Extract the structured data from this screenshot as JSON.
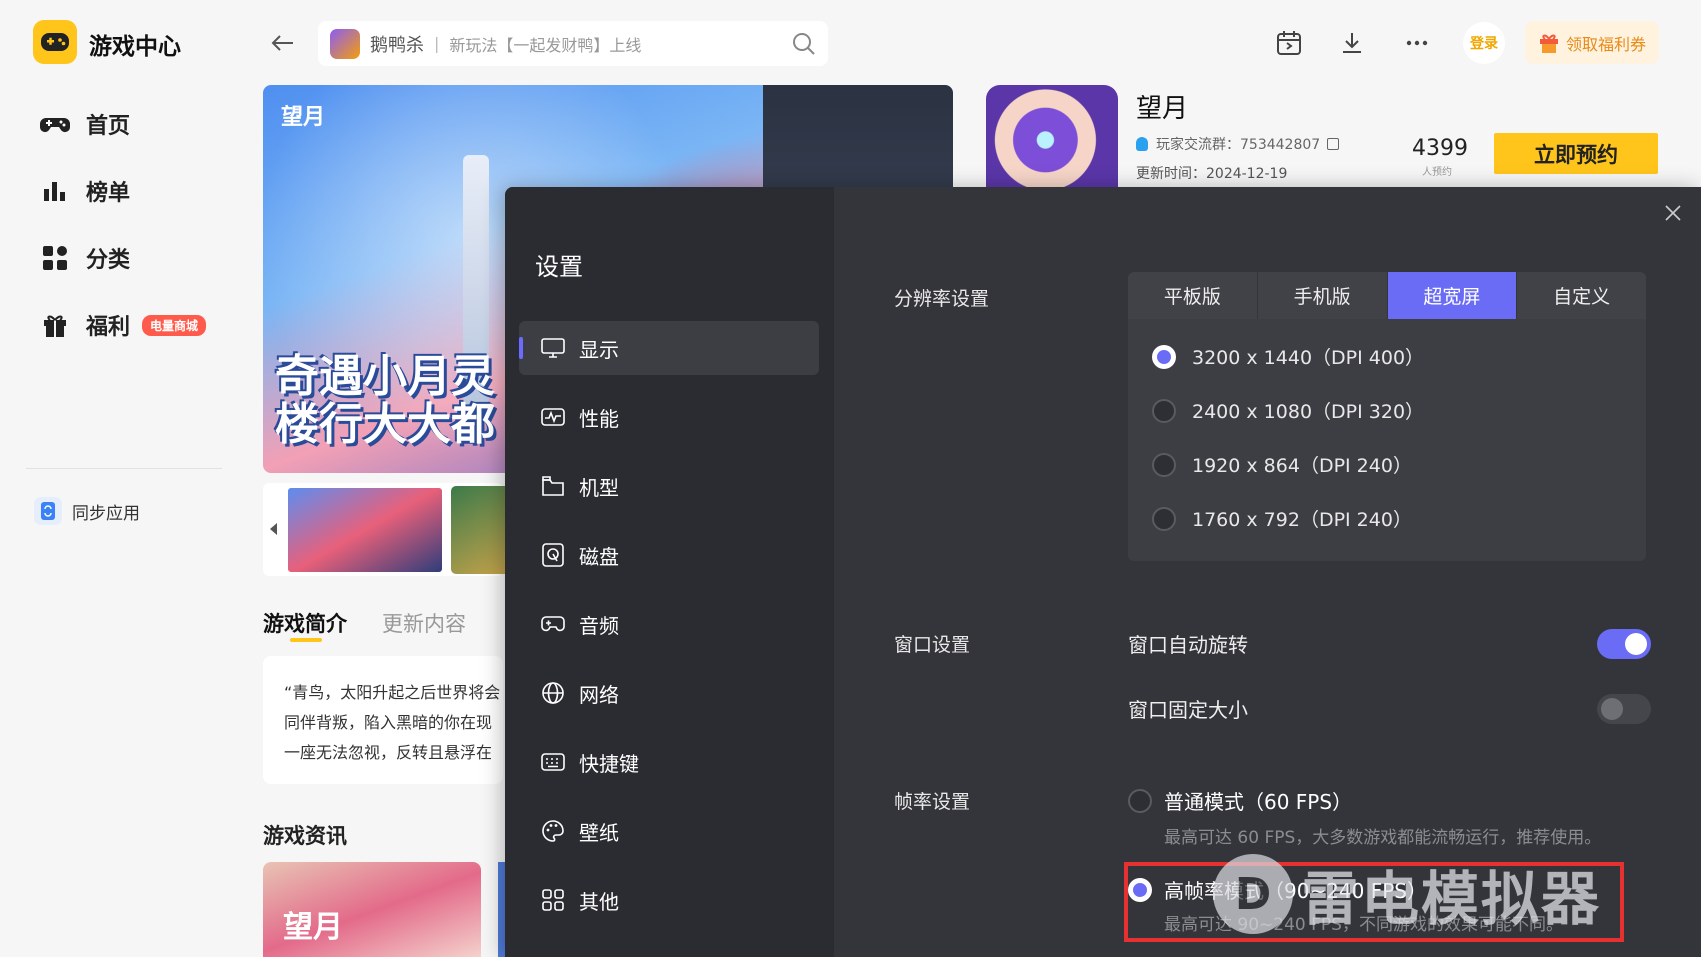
{
  "app": {
    "title": "游戏中心"
  },
  "sidebar": {
    "items": [
      {
        "label": "首页",
        "icon": "gamepad-icon"
      },
      {
        "label": "榜单",
        "icon": "bar-chart-icon"
      },
      {
        "label": "分类",
        "icon": "category-grid-icon"
      },
      {
        "label": "福利",
        "icon": "gift-icon",
        "badge": "电量商城"
      }
    ],
    "sync": {
      "label": "同步应用",
      "icon": "sync-app-icon"
    }
  },
  "topbar": {
    "search": {
      "game": "鹅鸭杀",
      "hint": "新玩法【一起发财鸭】上线",
      "sep": "|"
    },
    "login_label": "登录",
    "welfare_label": "领取福利券"
  },
  "banner": {
    "logo": "望月",
    "title_line1": "奇遇小月灵",
    "title_line2": "楼行大大都"
  },
  "main": {
    "tabs": [
      "游戏简介",
      "更新内容"
    ],
    "intro_lines": [
      "“青鸟，太阳升起之后世界将会",
      "同伴背叛，陷入黑暗的你在现",
      "一座无法忽视，反转且悬浮在"
    ],
    "news_title": "游戏资讯",
    "news_logo": "望月"
  },
  "game": {
    "name": "望月",
    "qq_group": "玩家交流群：753442807",
    "update_time": "更新时间：2024-12-19",
    "reserve_count": "4399",
    "reserve_count_label": "人预约",
    "reserve_btn": "立即预约"
  },
  "settings": {
    "title": "设置",
    "nav": [
      {
        "label": "显示",
        "icon": "monitor-icon",
        "active": true
      },
      {
        "label": "性能",
        "icon": "performance-icon",
        "active": false
      },
      {
        "label": "机型",
        "icon": "device-model-icon",
        "active": false
      },
      {
        "label": "磁盘",
        "icon": "disk-icon",
        "active": false
      },
      {
        "label": "音频",
        "icon": "audio-gamepad-icon",
        "active": false
      },
      {
        "label": "网络",
        "icon": "globe-icon",
        "active": false
      },
      {
        "label": "快捷键",
        "icon": "keyboard-icon",
        "active": false
      },
      {
        "label": "壁纸",
        "icon": "palette-icon",
        "active": false
      },
      {
        "label": "其他",
        "icon": "more-grid-icon",
        "active": false
      }
    ],
    "resolution": {
      "label": "分辨率设置",
      "tabs": [
        "平板版",
        "手机版",
        "超宽屏",
        "自定义"
      ],
      "active_tab": "超宽屏",
      "options": [
        {
          "label": "3200 x 1440（DPI 400）",
          "checked": true
        },
        {
          "label": "2400 x 1080（DPI 320）",
          "checked": false
        },
        {
          "label": "1920 x 864（DPI 240）",
          "checked": false
        },
        {
          "label": "1760 x 792（DPI 240）",
          "checked": false
        }
      ]
    },
    "window": {
      "label": "窗口设置",
      "auto_rotate": {
        "label": "窗口自动旋转",
        "on": true
      },
      "fixed_size": {
        "label": "窗口固定大小",
        "on": false
      }
    },
    "fps": {
      "label": "帧率设置",
      "normal": {
        "label": "普通模式（60 FPS）",
        "desc": "最高可达 60 FPS，大多数游戏都能流畅运行，推荐使用。",
        "checked": false
      },
      "high": {
        "label": "高帧率模式（90~240 FPS）",
        "desc": "最高可达 90~240 FPS，不同游戏的效果可能不同。",
        "checked": true
      }
    }
  },
  "watermark": {
    "logo": "D",
    "text": "雷电模拟器"
  },
  "colors": {
    "accent": "#6a6cf6",
    "brand_yellow": "#ffc51b",
    "modal_bg": "#34353a",
    "highlight_red": "#e5312f"
  }
}
